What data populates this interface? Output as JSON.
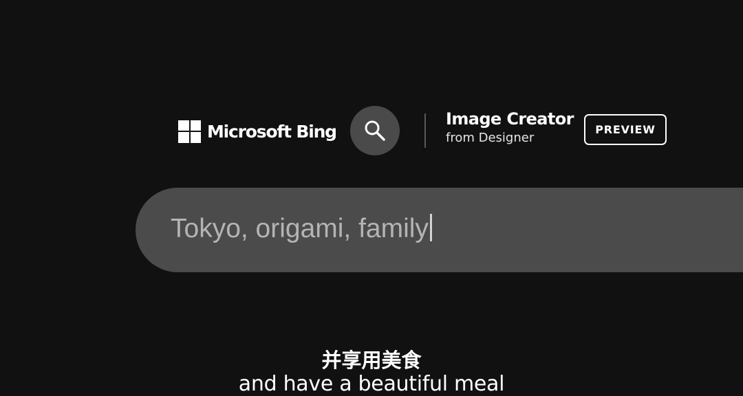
{
  "brand": {
    "name": "Microsoft Bing",
    "logo_icon": "windows-logo-icon"
  },
  "search_button": {
    "icon": "search-icon",
    "background": "#4a4a4a"
  },
  "app_title": {
    "name": "Image Creator",
    "subtitle": "from Designer",
    "badge": "PREVIEW"
  },
  "prompt": {
    "value": "Tokyo, origami, family",
    "background": "#4b4b4b",
    "text_color": "#b4b4b4"
  },
  "captions": {
    "chinese": "并享用美食",
    "english": "and have a beautiful meal"
  },
  "colors": {
    "page_background": "#111111",
    "text": "#ffffff"
  }
}
